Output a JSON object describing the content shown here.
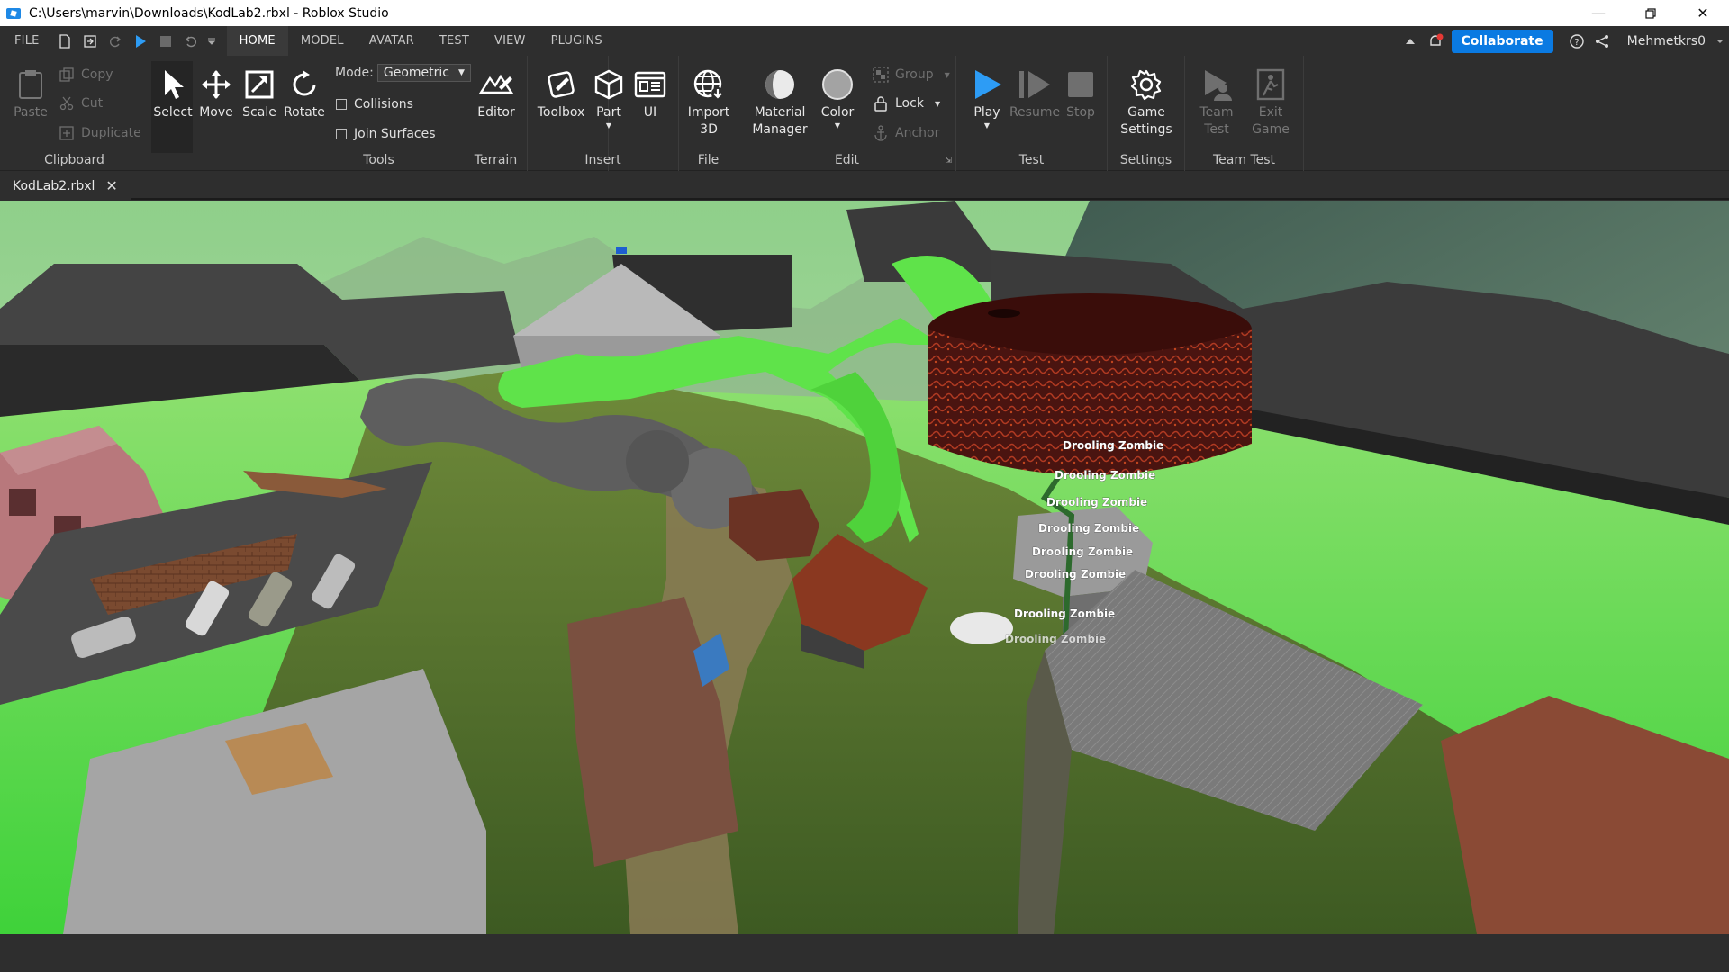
{
  "window": {
    "title": "C:\\Users\\marvin\\Downloads\\KodLab2.rbxl - Roblox Studio"
  },
  "menu": {
    "items": [
      "FILE",
      "HOME",
      "MODEL",
      "AVATAR",
      "TEST",
      "VIEW",
      "PLUGINS"
    ],
    "active": "HOME",
    "collaborate_label": "Collaborate",
    "user_name": "Mehmetkrs0"
  },
  "ribbon": {
    "clipboard": {
      "paste": "Paste",
      "copy": "Copy",
      "cut": "Cut",
      "duplicate": "Duplicate",
      "label": "Clipboard"
    },
    "tools": {
      "select": "Select",
      "move": "Move",
      "scale": "Scale",
      "rotate": "Rotate",
      "mode_label": "Mode:",
      "mode_value": "Geometric",
      "collisions": "Collisions",
      "join_surfaces": "Join Surfaces",
      "label": "Tools"
    },
    "terrain": {
      "editor": "Editor",
      "label": "Terrain"
    },
    "insert": {
      "toolbox": "Toolbox",
      "part": "Part",
      "ui": "UI",
      "label": "Insert"
    },
    "file": {
      "import_line1": "Import",
      "import_line2": "3D",
      "label": "File"
    },
    "edit": {
      "material_line1": "Material",
      "material_line2": "Manager",
      "color": "Color",
      "group": "Group",
      "lock": "Lock",
      "anchor": "Anchor",
      "label": "Edit"
    },
    "test": {
      "play": "Play",
      "resume": "Resume",
      "stop": "Stop",
      "label": "Test"
    },
    "settings": {
      "game_line1": "Game",
      "game_line2": "Settings",
      "label": "Settings"
    },
    "team_test": {
      "team_line1": "Team",
      "team_line2": "Test",
      "exit_line1": "Exit",
      "exit_line2": "Game",
      "label": "Team Test"
    }
  },
  "tabs": {
    "document": "KodLab2.rbxl"
  },
  "viewport": {
    "npc_labels": [
      "Drooling Zombie",
      "Drooling Zombie",
      "Drooling Zombie",
      "Drooling Zombie",
      "Drooling Zombie",
      "Drooling Zombie",
      "Drooling Zombie",
      "Drooling Zombie"
    ]
  },
  "colors": {
    "accent": "#0a7ae2",
    "play": "#2d9cf5",
    "ribbon_bg": "#2e2e2e",
    "slime": "#5fe34a",
    "lava": "#6a1a12"
  }
}
